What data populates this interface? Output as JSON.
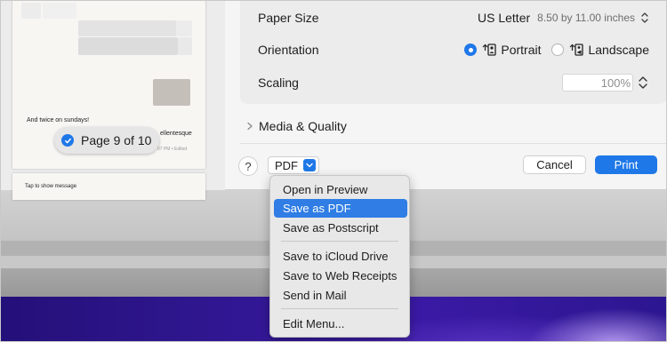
{
  "preview": {
    "snippet_line1": "And twice on sundays!",
    "snippet_partial": "ellentesque",
    "snippet_time": "07 PM • Edited",
    "snippet_line2": "Tap to show message",
    "page_badge": "Page 9 of 10"
  },
  "settings": {
    "paper_size_label": "Paper Size",
    "paper_size_value": "US Letter",
    "paper_size_detail": "8.50 by 11.00 inches",
    "orientation_label": "Orientation",
    "portrait_label": "Portrait",
    "landscape_label": "Landscape",
    "orientation_selected": "Portrait",
    "scaling_label": "Scaling",
    "scaling_value": "100%",
    "media_quality_label": "Media & Quality"
  },
  "bottom_bar": {
    "help_label": "?",
    "pdf_label": "PDF",
    "cancel_label": "Cancel",
    "print_label": "Print"
  },
  "pdf_menu": {
    "selected": "Save as PDF",
    "items": [
      "Open in Preview",
      "Save as PDF",
      "Save as Postscript",
      "Save to iCloud Drive",
      "Save to Web Receipts",
      "Send in Mail",
      "Edit Menu..."
    ]
  },
  "colors": {
    "accent": "#1f78e8",
    "menu_highlight": "#2f7de5",
    "sheet_bg": "#f5f5f5",
    "settings_bg": "#ececec"
  }
}
